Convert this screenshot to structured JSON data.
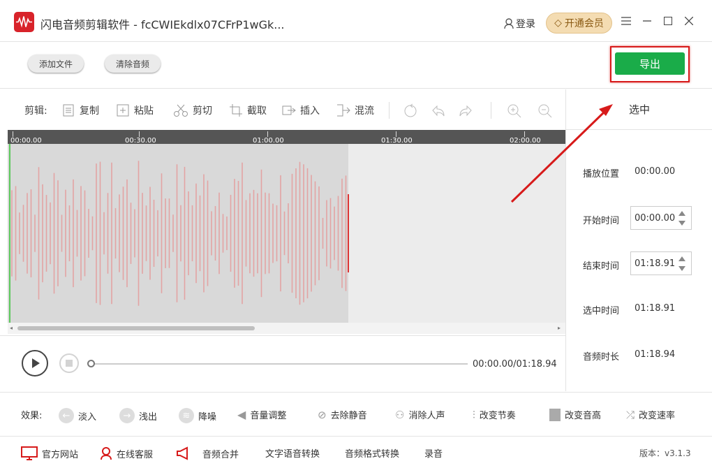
{
  "app": {
    "title": "闪电音频剪辑软件 - fcCWIEkdlx07CFrP1wGk...",
    "login": "登录",
    "vip": "开通会员"
  },
  "toolbar": {
    "add_file": "添加文件",
    "clear_audio": "清除音频",
    "export": "导出"
  },
  "edit": {
    "label": "剪辑:",
    "tools": [
      "复制",
      "粘贴",
      "剪切",
      "截取",
      "插入",
      "混流"
    ]
  },
  "timeline": {
    "ticks": [
      "00:00.00",
      "00:30.00",
      "01:00.00",
      "01:30.00",
      "02:00.00"
    ]
  },
  "player": {
    "time": "00:00.00/01:18.94"
  },
  "selection": {
    "title": "选中",
    "play_position_label": "播放位置",
    "play_position": "00:00.00",
    "start_label": "开始时间",
    "start": "00:00.00",
    "end_label": "结束时间",
    "end": "01:18.91",
    "selected_label": "选中时间",
    "selected": "01:18.91",
    "duration_label": "音频时长",
    "duration": "01:18.94"
  },
  "effects": {
    "label": "效果:",
    "items": [
      "淡入",
      "浅出",
      "降噪",
      "音量调整",
      "去除静音",
      "消除人声",
      "改变节奏",
      "改变音高",
      "改变速率"
    ]
  },
  "bottom": {
    "links": [
      "官方网站",
      "在线客服",
      "音频合并",
      "文字语音转换",
      "音频格式转换",
      "录音"
    ],
    "version": "版本：v3.1.3"
  },
  "colors": {
    "accent_green": "#1aac49",
    "highlight_red": "#d71a1a",
    "wave": "#e3a3a3"
  }
}
